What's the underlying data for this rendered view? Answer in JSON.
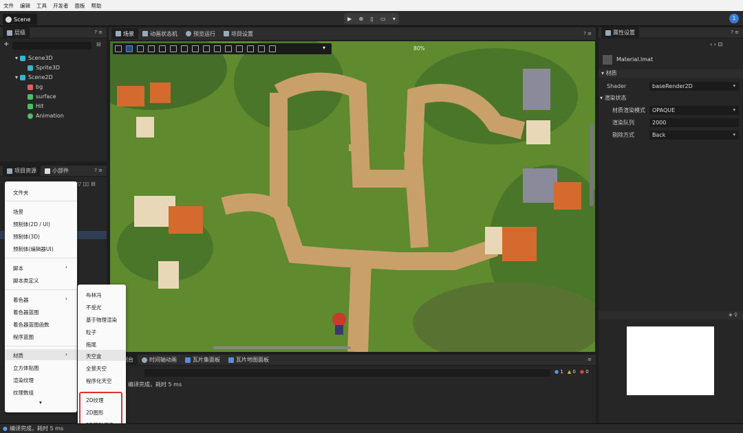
{
  "menu": [
    "文件",
    "编辑",
    "工具",
    "开发者",
    "面板",
    "帮助"
  ],
  "scene_tab": "Scene",
  "notif_count": "1",
  "hierarchy": {
    "tab": "层级",
    "items": [
      {
        "label": "Scene3D",
        "color": "#3ab4c9"
      },
      {
        "label": "Sprite3D",
        "color": "#3ab4c9"
      },
      {
        "label": "Scene2D",
        "color": "#3ab4c9"
      },
      {
        "label": "bg",
        "color": "#e06060"
      },
      {
        "label": "surface",
        "color": "#4ac060"
      },
      {
        "label": "Hit",
        "color": "#4ac060"
      },
      {
        "label": "Animation",
        "color": "#4ac060"
      }
    ]
  },
  "assets": {
    "tab1": "项目资源",
    "tab2": "小部件"
  },
  "context_menu": {
    "items": [
      "文件夹",
      "场景",
      "预制体(2D / UI)",
      "预制体(3D)",
      "预制体(编辑器UI)",
      "脚本",
      "脚本类定义",
      "着色器",
      "着色器蓝图",
      "着色器蓝图函数",
      "程序蓝图",
      "材质",
      "立方体贴图",
      "渲染纹理",
      "纹理数组"
    ],
    "more": "▾"
  },
  "submenu": {
    "items": [
      "布林冯",
      "不受光",
      "基于物理渲染",
      "粒子",
      "拖尾",
      "天空盒",
      "全景天空",
      "程序化天空",
      "2D纹理",
      "2D图形",
      "2D基础渲染"
    ]
  },
  "center_tabs": [
    "场景",
    "动画状态机",
    "预览运行",
    "项目设置"
  ],
  "zoom": "80%",
  "bottom_tabs": [
    "控制台",
    "时间轴动画",
    "瓦片集面板",
    "瓦片地图面板"
  ],
  "console": {
    "line": "编译完成，耗时 5 ms",
    "counts": {
      "info": "1",
      "warn": "0",
      "error": "0"
    }
  },
  "properties": {
    "tab": "属性设置",
    "material_name": "Material.lmat",
    "section_material": "材质",
    "shader_label": "Shader",
    "shader_value": "baseRender2D",
    "section_render": "渲染状态",
    "rows": [
      {
        "label": "材质渲染模式",
        "value": "OPAQUE"
      },
      {
        "label": "渲染队列",
        "value": "2000"
      },
      {
        "label": "剔除方式",
        "value": "Back"
      }
    ]
  },
  "status": "编译完成，耗时 5 ms"
}
